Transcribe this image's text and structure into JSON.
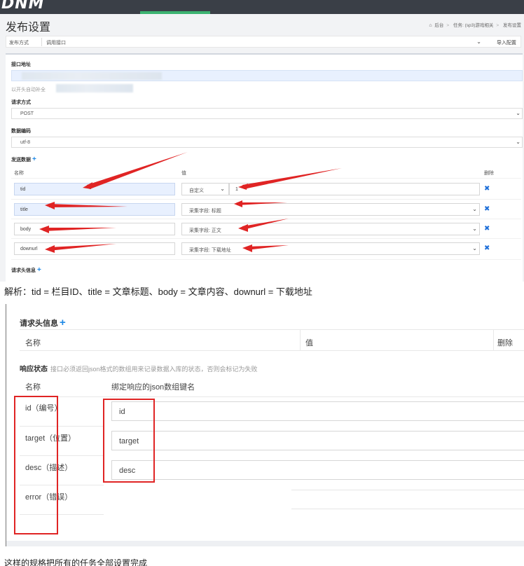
{
  "banner": {
    "brand": "DNM"
  },
  "page": {
    "title": "发布设置",
    "breadcrumb": [
      "后台",
      "任务: (sp3)游戏相关",
      "发布设置"
    ]
  },
  "method_bar": {
    "label": "发布方式",
    "value": "调用接口",
    "import_label": "导入配置"
  },
  "form": {
    "url_label": "接口地址",
    "url_hint": "以开头自动补全",
    "method_label": "请求方式",
    "method_value": "POST",
    "encoding_label": "数据编码",
    "encoding_value": "utf-8",
    "post_data_label": "发送数据",
    "columns": {
      "name": "名称",
      "value": "值",
      "delete": "删除"
    },
    "rows": [
      {
        "name": "tid",
        "type": "自定义",
        "value": "1"
      },
      {
        "name": "title",
        "value": "采集字段: 标题"
      },
      {
        "name": "body",
        "value": "采集字段: 正文"
      },
      {
        "name": "downurl",
        "value": "采集字段: 下载地址"
      }
    ],
    "header_label": "请求头信息"
  },
  "caption1": "解析：tid = 栏目ID、title = 文章标题、body = 文章内容、downurl = 下载地址",
  "shot2": {
    "header_label": "请求头信息",
    "columns": {
      "name": "名称",
      "value": "值",
      "delete": "删除"
    },
    "response_label": "响应状态",
    "response_hint": "接口必须返回json格式的数组用来记录数据入库的状态，否则会标记为失败",
    "resp_columns": {
      "name": "名称",
      "key": "绑定响应的json数组键名"
    },
    "resp_rows": [
      {
        "name": "id（编号）",
        "value": "id"
      },
      {
        "name": "target（位置）",
        "value": "target"
      },
      {
        "name": "desc（描述）",
        "value": "desc"
      },
      {
        "name": "error（错误）",
        "value": ""
      }
    ]
  },
  "caption2": "这样的规格把所有的任务全部设置完成",
  "colors": {
    "accent": "#1e88e5",
    "delete_x": "#1e6fd9",
    "annotation": "#e02424"
  },
  "icons": {
    "home": "home-icon",
    "plus": "plus-icon",
    "delete": "close-x-icon",
    "caret": "chevron-down-icon"
  }
}
